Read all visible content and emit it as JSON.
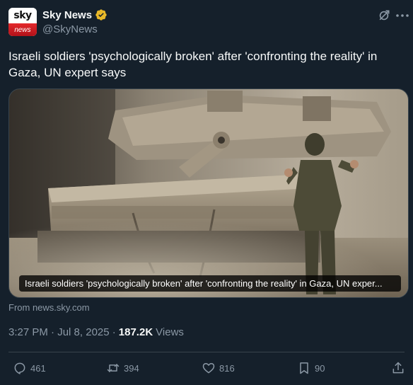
{
  "author": {
    "avatar_top_text": "sky",
    "avatar_bottom_text": "news",
    "display_name": "Sky News",
    "handle": "@SkyNews",
    "verified": true
  },
  "tweet": {
    "text": "Israeli soldiers 'psychologically broken' after 'confronting the reality' in Gaza, UN expert says",
    "card_caption": "Israeli soldiers 'psychologically broken' after 'confronting the reality' in Gaza, UN exper...",
    "card_source": "From news.sky.com",
    "time": "3:27 PM",
    "date": "Jul 8, 2025",
    "views_count": "187.2K",
    "views_label": "Views"
  },
  "actions": {
    "replies": "461",
    "reposts": "394",
    "likes": "816",
    "bookmarks": "90"
  },
  "icons": {
    "grok": "grok-icon",
    "more": "more-icon",
    "reply": "reply-icon",
    "repost": "repost-icon",
    "like": "heart-icon",
    "bookmark": "bookmark-icon",
    "share": "share-icon"
  },
  "colors": {
    "background": "#15202b",
    "text": "#f7f9f9",
    "secondary": "#8b98a5",
    "verified_badge": "#e8b829",
    "brand_red": "#e4282b"
  }
}
